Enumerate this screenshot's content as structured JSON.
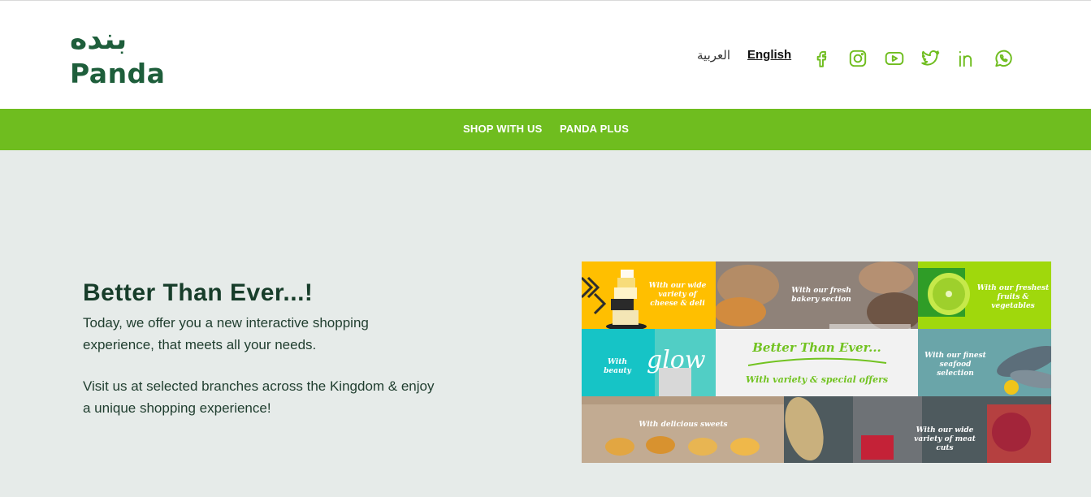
{
  "header": {
    "logo": {
      "arabic": "بنده",
      "english": "Panda"
    },
    "languages": {
      "arabic": "العربية",
      "english": "English"
    },
    "social": [
      "facebook-icon",
      "instagram-icon",
      "youtube-icon",
      "twitter-icon",
      "linkedin-icon",
      "whatsapp-icon"
    ]
  },
  "nav": {
    "items": [
      "SHOP WITH US",
      "PANDA PLUS"
    ]
  },
  "hero": {
    "title": "Better Than Ever...!",
    "paragraph1": "Today, we offer you a new interactive shopping experience, that meets all your needs.",
    "paragraph2": "Visit us at selected branches across the Kingdom & enjoy a unique shopping experience!"
  },
  "collage": {
    "tiles": [
      "With our wide variety of cheese & deli",
      "With our fresh bakery section",
      "With our freshest fruits & vegetables",
      "With beauty",
      "glow",
      "Better Than Ever...",
      "With variety & special offers",
      "With our finest seafood selection",
      "With delicious sweets",
      "With our wide variety of meat cuts"
    ]
  },
  "colors": {
    "brand_green": "#6fbd1f",
    "dark_green": "#1e5e3b",
    "accent_red": "#e8462e",
    "page_bg": "#e6ebe9"
  }
}
